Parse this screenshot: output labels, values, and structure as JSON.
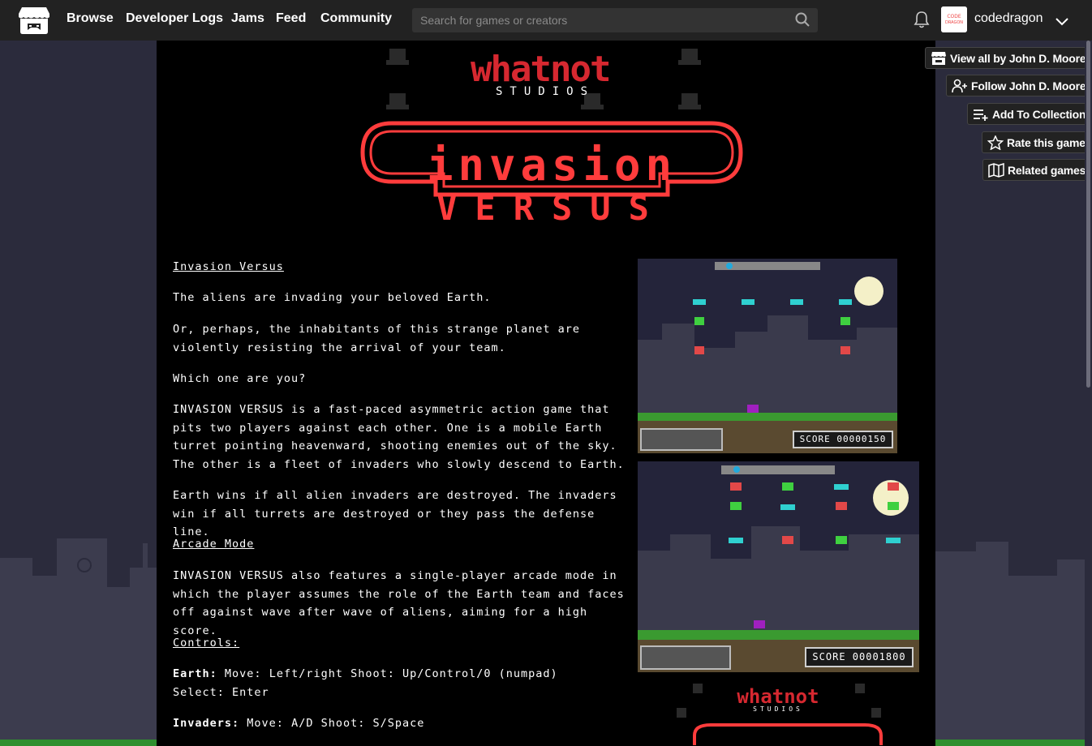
{
  "nav": {
    "links": [
      "Browse",
      "Developer Logs",
      "Jams",
      "Feed",
      "Community"
    ],
    "search_placeholder": "Search for games or creators",
    "username": "codedragon",
    "avatar_text": "CODE DRAGON"
  },
  "studio": {
    "name": "whatnot",
    "sub": "STUDIOS"
  },
  "game_title": {
    "line1": "invasion",
    "line2": "VERSUS"
  },
  "description": {
    "heading1": "Invasion Versus",
    "p1": "The aliens are invading your beloved Earth.",
    "p2": "Or, perhaps, the inhabitants of this strange planet are violently resisting the arrival of your team.",
    "p3": "Which one are you?",
    "p4": "INVASION VERSUS is a fast-paced asymmetric action game that pits two players against each other. One is a mobile Earth turret pointing heavenward, shooting enemies out of the sky. The other is a fleet of invaders who slowly descend to Earth.",
    "p5": "Earth wins if all alien invaders are destroyed. The invaders win if all turrets are destroyed or they pass the defense line.",
    "heading2": "Arcade Mode",
    "p6": "INVASION VERSUS also features a single-player arcade mode in which the player assumes the role of the Earth team and faces off against wave after wave of aliens, aiming for a high score.",
    "heading3": "Controls:",
    "earth_label": "Earth:",
    "earth_controls": "Move: Left/right Shoot: Up/Control/0 (numpad)",
    "earth_select": "Select: Enter",
    "invaders_label": "Invaders:",
    "invaders_controls": "Move: A/D Shoot: S/Space"
  },
  "screenshots": [
    {
      "score": "SCORE 00000150"
    },
    {
      "score": "SCORE 00001800"
    }
  ],
  "actions": [
    {
      "label": "View all by John D. Moore",
      "icon": "storefront-icon"
    },
    {
      "label": "Follow John D. Moore",
      "icon": "follow-user-icon"
    },
    {
      "label": "Add To Collection",
      "icon": "add-to-list-icon"
    },
    {
      "label": "Rate this game",
      "icon": "star-icon"
    },
    {
      "label": "Related games",
      "icon": "map-icon"
    }
  ],
  "colors": {
    "accent_red": "#ff3c3c",
    "studio_red": "#d62830",
    "nav_bg": "#222222",
    "page_bg": "#2b2b3c"
  }
}
